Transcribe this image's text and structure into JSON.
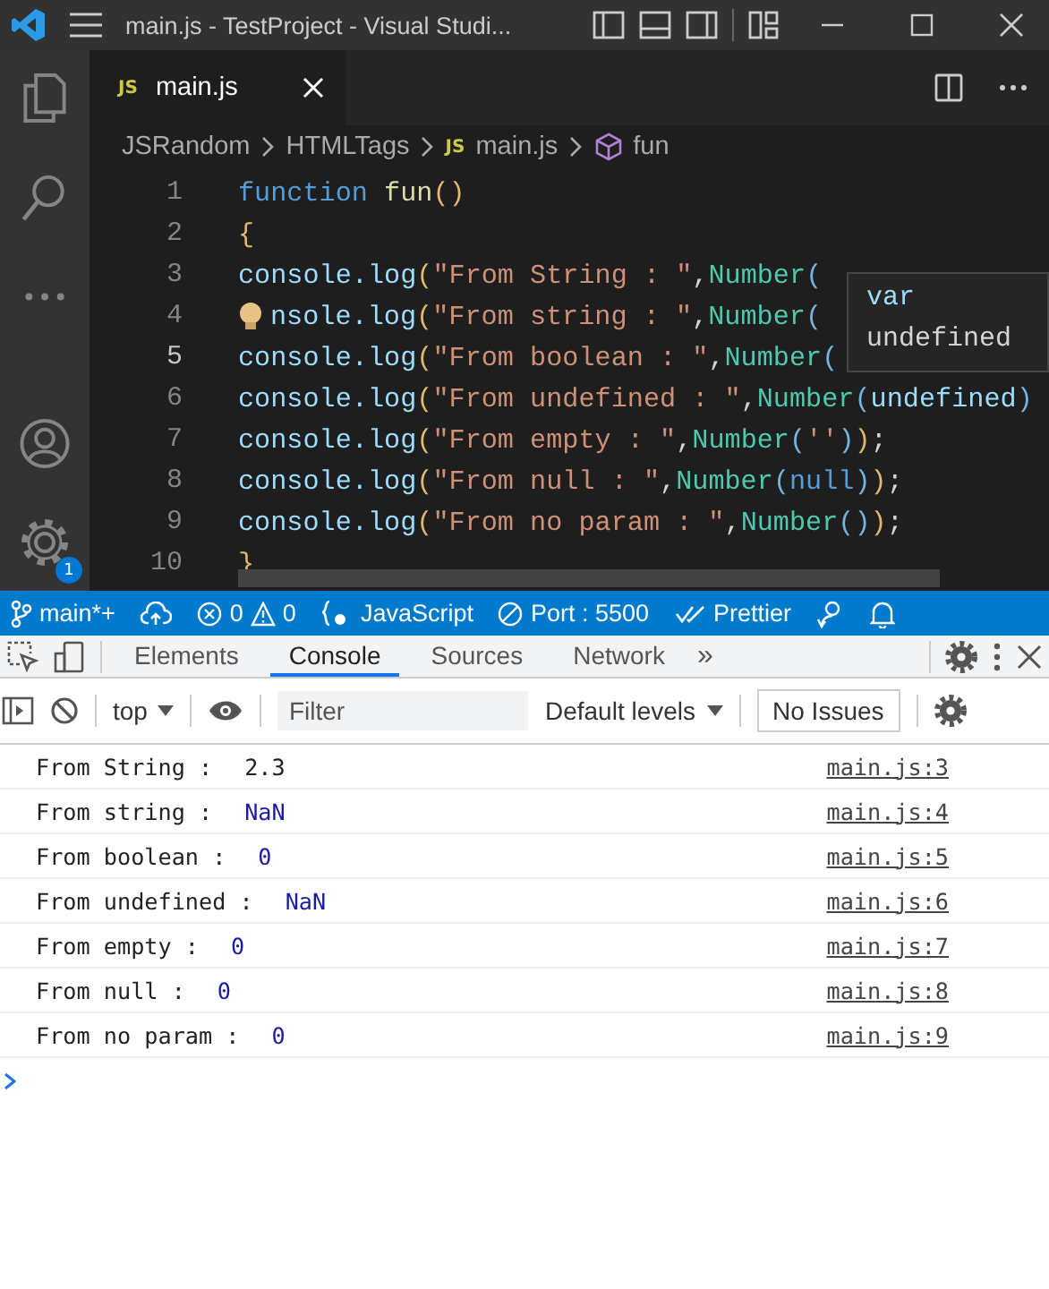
{
  "title_bar": {
    "title": "main.js - TestProject - Visual Studi..."
  },
  "activity_bar": {
    "settings_badge": "1"
  },
  "editor_tabs": [
    {
      "icon_text": "JS",
      "label": "main.js",
      "selected": true
    }
  ],
  "breadcrumbs": [
    {
      "text": "JSRandom",
      "kind": "folder"
    },
    {
      "text": "HTMLTags",
      "kind": "folder"
    },
    {
      "text": "main.js",
      "kind": "file",
      "icon_text": "JS"
    },
    {
      "text": "fun",
      "kind": "symbol"
    }
  ],
  "code_lines": [
    {
      "number": "1",
      "current": false,
      "lightbulb": false,
      "tokens": [
        {
          "text": "function ",
          "kind": "keyword"
        },
        {
          "text": "fun",
          "kind": "func"
        },
        {
          "text": "()",
          "kind": "paren"
        }
      ]
    },
    {
      "number": "2",
      "current": false,
      "lightbulb": false,
      "tokens": [
        {
          "text": "{",
          "kind": "paren"
        }
      ]
    },
    {
      "number": "3",
      "current": false,
      "lightbulb": false,
      "tokens": [
        {
          "text": "console.log",
          "kind": "var"
        },
        {
          "text": "(",
          "kind": "paren"
        },
        {
          "text": "\"From String : \"",
          "kind": "string"
        },
        {
          "text": ",",
          "kind": "plain"
        },
        {
          "text": "Number",
          "kind": "type"
        },
        {
          "text": "(",
          "kind": "bracket"
        }
      ]
    },
    {
      "number": "4",
      "current": false,
      "lightbulb": true,
      "tokens": [
        {
          "text": "nsole.log",
          "kind": "var"
        },
        {
          "text": "(",
          "kind": "paren"
        },
        {
          "text": "\"From string : \"",
          "kind": "string"
        },
        {
          "text": ",",
          "kind": "plain"
        },
        {
          "text": "Number",
          "kind": "type"
        },
        {
          "text": "(",
          "kind": "bracket"
        }
      ]
    },
    {
      "number": "5",
      "current": true,
      "lightbulb": false,
      "tokens": [
        {
          "text": "console.log",
          "kind": "var"
        },
        {
          "text": "(",
          "kind": "paren"
        },
        {
          "text": "\"From boolean : \"",
          "kind": "string"
        },
        {
          "text": ",",
          "kind": "plain"
        },
        {
          "text": "Number",
          "kind": "type"
        },
        {
          "text": "(",
          "kind": "bracket"
        }
      ]
    },
    {
      "number": "6",
      "current": false,
      "lightbulb": false,
      "tokens": [
        {
          "text": "console.log",
          "kind": "var"
        },
        {
          "text": "(",
          "kind": "paren"
        },
        {
          "text": "\"From undefined : \"",
          "kind": "string"
        },
        {
          "text": ",",
          "kind": "plain"
        },
        {
          "text": "Number",
          "kind": "type"
        },
        {
          "text": "(",
          "kind": "bracket"
        },
        {
          "text": "undefined",
          "kind": "var"
        },
        {
          "text": ")",
          "kind": "bracket"
        }
      ]
    },
    {
      "number": "7",
      "current": false,
      "lightbulb": false,
      "tokens": [
        {
          "text": "console.log",
          "kind": "var"
        },
        {
          "text": "(",
          "kind": "paren"
        },
        {
          "text": "\"From empty : \"",
          "kind": "string"
        },
        {
          "text": ",",
          "kind": "plain"
        },
        {
          "text": "Number",
          "kind": "type"
        },
        {
          "text": "(",
          "kind": "bracket"
        },
        {
          "text": "''",
          "kind": "string"
        },
        {
          "text": ")",
          "kind": "bracket"
        },
        {
          "text": ")",
          "kind": "paren"
        },
        {
          "text": ";",
          "kind": "plain"
        }
      ]
    },
    {
      "number": "8",
      "current": false,
      "lightbulb": false,
      "tokens": [
        {
          "text": "console.log",
          "kind": "var"
        },
        {
          "text": "(",
          "kind": "paren"
        },
        {
          "text": "\"From null : \"",
          "kind": "string"
        },
        {
          "text": ",",
          "kind": "plain"
        },
        {
          "text": "Number",
          "kind": "type"
        },
        {
          "text": "(",
          "kind": "bracket"
        },
        {
          "text": "null",
          "kind": "keyword"
        },
        {
          "text": ")",
          "kind": "bracket"
        },
        {
          "text": ")",
          "kind": "paren"
        },
        {
          "text": ";",
          "kind": "plain"
        }
      ]
    },
    {
      "number": "9",
      "current": false,
      "lightbulb": false,
      "tokens": [
        {
          "text": "console.log",
          "kind": "var"
        },
        {
          "text": "(",
          "kind": "paren"
        },
        {
          "text": "\"From no param : \"",
          "kind": "string"
        },
        {
          "text": ",",
          "kind": "plain"
        },
        {
          "text": "Number",
          "kind": "type"
        },
        {
          "text": "()",
          "kind": "bracket"
        },
        {
          "text": ")",
          "kind": "paren"
        },
        {
          "text": ";",
          "kind": "plain"
        }
      ]
    },
    {
      "number": "10",
      "current": false,
      "lightbulb": false,
      "tokens": [
        {
          "text": "}",
          "kind": "paren"
        }
      ]
    }
  ],
  "hover": {
    "items": [
      "var",
      "undefined"
    ]
  },
  "status_bar": {
    "branch": "main*+",
    "errors": "0",
    "warnings": "0",
    "language": "JavaScript",
    "port": "Port : 5500",
    "formatter": "Prettier"
  },
  "devtools": {
    "tabs": [
      {
        "label": "Elements",
        "selected": false
      },
      {
        "label": "Console",
        "selected": true
      },
      {
        "label": "Sources",
        "selected": false
      },
      {
        "label": "Network",
        "selected": false
      }
    ],
    "more_tabs": "»",
    "context": "top",
    "filter_placeholder": "Filter",
    "levels": "Default levels",
    "issues": "No Issues"
  },
  "console": {
    "messages": [
      {
        "text": "From String :",
        "value": "2.3",
        "kind": "string",
        "source": "main.js:3"
      },
      {
        "text": "From string :",
        "value": "NaN",
        "kind": "number",
        "source": "main.js:4"
      },
      {
        "text": "From boolean :",
        "value": "0",
        "kind": "number",
        "source": "main.js:5"
      },
      {
        "text": "From undefined :",
        "value": "NaN",
        "kind": "number",
        "source": "main.js:6"
      },
      {
        "text": "From empty :",
        "value": "0",
        "kind": "number",
        "source": "main.js:7"
      },
      {
        "text": "From null :",
        "value": "0",
        "kind": "number",
        "source": "main.js:8"
      },
      {
        "text": "From no param :",
        "value": "0",
        "kind": "number",
        "source": "main.js:9"
      }
    ]
  }
}
